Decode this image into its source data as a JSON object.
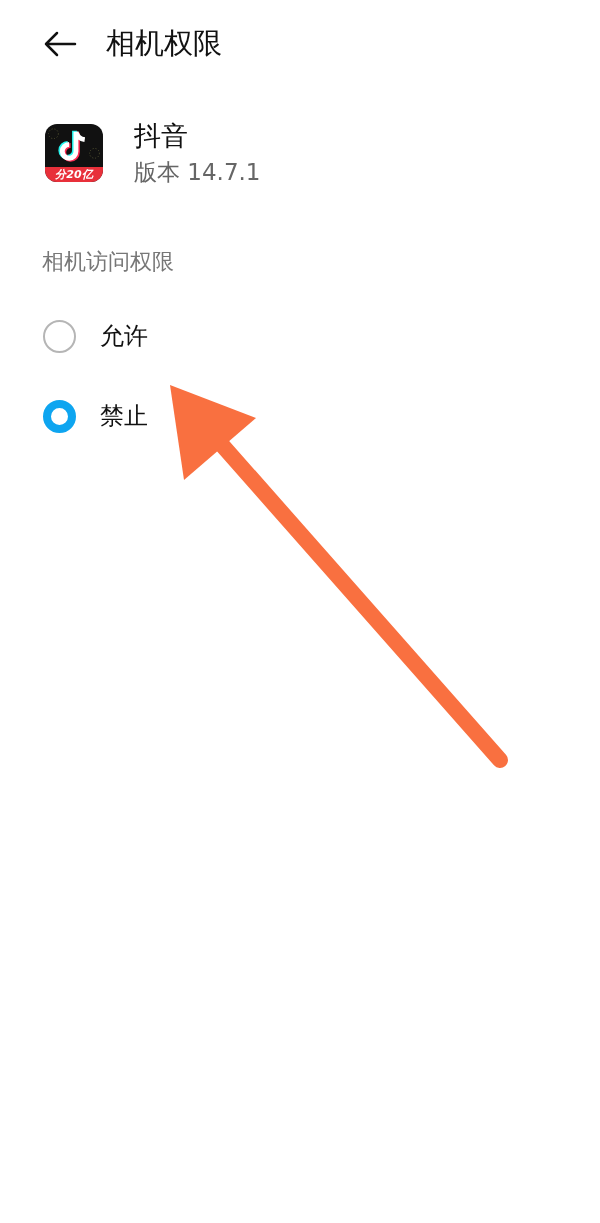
{
  "header": {
    "title": "相机权限"
  },
  "app": {
    "name": "抖音",
    "version": "版本 14.7.1",
    "icon_badge": "分20亿"
  },
  "section": {
    "label": "相机访问权限"
  },
  "options": [
    {
      "label": "允许",
      "selected": false
    },
    {
      "label": "禁止",
      "selected": true
    }
  ],
  "annotation": {
    "kind": "arrow"
  }
}
